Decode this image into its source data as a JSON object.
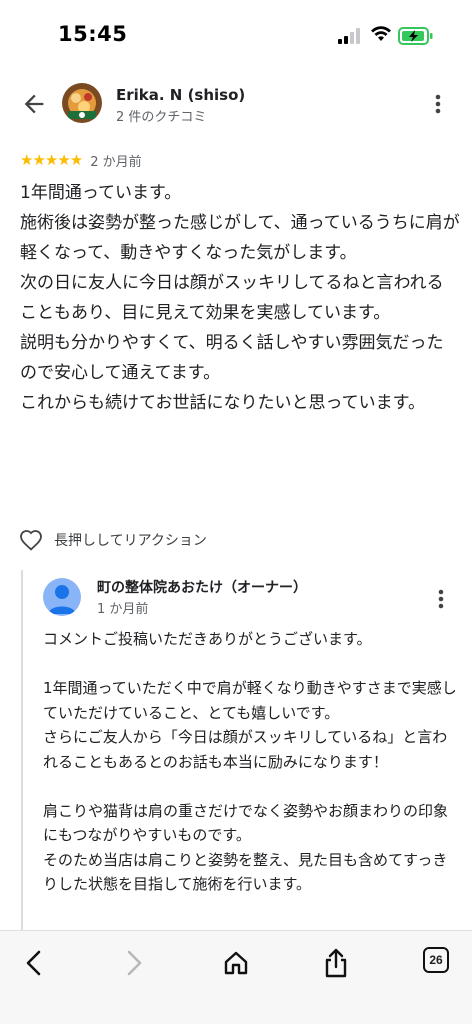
{
  "status_bar": {
    "time": "15:45"
  },
  "header": {
    "reviewer_name": "Erika. N (shiso)",
    "review_count": "2 件のクチコミ"
  },
  "review": {
    "stars": "★★★★★",
    "rating": 5,
    "date": "2 か月前",
    "text": "1年間通っています。\n施術後は姿勢が整った感じがして、通っているうちに肩が軽くなって、動きやすくなった気がします。\n次の日に友人に今日は顔がスッキリしてるねと言われることもあり、目に見えて効果を実感しています。\n説明も分かりやすくて、明るく話しやすい雰囲気だったので安心して通えてます。\nこれからも続けてお世話になりたいと思っています。"
  },
  "reaction": {
    "label": "長押ししてリアクション"
  },
  "owner_reply": {
    "name": "町の整体院あおたけ（オーナー）",
    "date": "1 か月前",
    "text": "コメントご投稿いただきありがとうございます。\n\n1年間通っていただく中で肩が軽くなり動きやすさまで実感していただけていること、とても嬉しいです。\nさらにご友人から「今日は顔がスッキリしているね」と言われることもあるとのお話も本当に励みになります！\n\n肩こりや猫背は肩の重さだけでなく姿勢やお顔まわりの印象にもつながりやすいものです。\nそのため当店は肩こりと姿勢を整え、見た目も含めてすっきりした状態を目指して施術を行います。"
  },
  "toolbar": {
    "tabs_count": "26"
  },
  "colors": {
    "star": "#fbbc04",
    "text": "#202124",
    "secondary_text": "#5f6368",
    "owner_avatar": "#8ab4f8",
    "battery_fill": "#34c759"
  },
  "icons": [
    "back-arrow-icon",
    "more-vert-icon",
    "heart-outline-icon",
    "chevron-left-icon",
    "chevron-right-icon",
    "home-icon",
    "share-icon",
    "tabs-icon",
    "signal-icon",
    "wifi-icon",
    "battery-icon"
  ]
}
